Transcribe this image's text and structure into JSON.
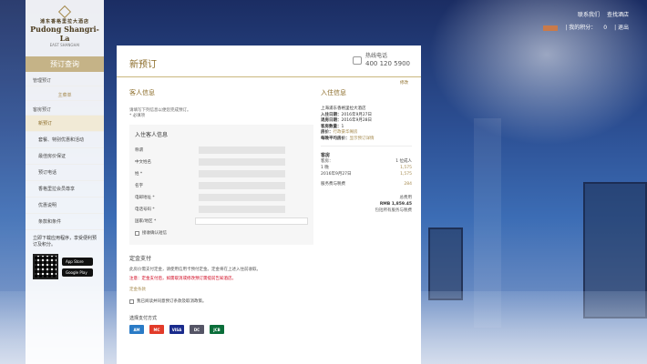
{
  "topbar": {
    "contact_us": "联系我们",
    "hotel_search": "查找酒店",
    "points_label": "| 我的积分：",
    "points_value": "0",
    "logout": "| 退出"
  },
  "sidebar": {
    "logo_cn": "浦东香格里拉大酒店",
    "logo_en": "Pudong Shangri-La",
    "logo_sub": "EAST SHANGHAI",
    "title": "预订查询",
    "group_manage": "管理预订",
    "section_center": "主菜单",
    "group_book": "客房预订",
    "items": [
      {
        "label": "新预订"
      },
      {
        "label": "套餐、特别优惠和活动"
      },
      {
        "label": "最佳房价保证"
      },
      {
        "label": "预订电话"
      },
      {
        "label": "香格里拉会员尊享"
      },
      {
        "label": "优惠说明"
      },
      {
        "label": "条款和条件"
      }
    ],
    "promo": "立即下载应用程序，享受便利预订及积分。",
    "app_store": "App Store",
    "google_play": "Google Play"
  },
  "panel": {
    "title": "新预订",
    "phone_label": "热线电话",
    "phone_number": "400 120 5900",
    "edit": "修改",
    "guest_info_title": "客人信息",
    "note_line1": "请填写下列信息以便您完成预订。",
    "note_line2": "* 必填项",
    "guest_sub": "入住客人信息",
    "fields": [
      {
        "label": "称谓"
      },
      {
        "label": "中文姓名"
      },
      {
        "label": "姓 *"
      },
      {
        "label": "名字"
      },
      {
        "label": "电邮地址 *"
      },
      {
        "label": "电话号码 *"
      },
      {
        "label": "国家/地区 *"
      }
    ],
    "send_confirm": "接收确认短信",
    "deposit_title": "定金支付",
    "deposit_text": "此房价需支付定金，请使用信用卡预付定金。定金将在上述入住前收取。",
    "red_note": "注意：定金支付后，如需取消或修改预订需提前告知酒店。",
    "deposit_link": "定金条款",
    "agree_text": "我已阅读并同意预订条款及取消政策。",
    "pay_title": "选择支付方式",
    "stay_title": "入住信息",
    "hotel_name": "上海浦东香格里拉大酒店",
    "checkin_label": "入住日期：",
    "checkin_value": "2016年9月27日",
    "checkout_label": "退房日期：",
    "checkout_value": "2016年9月28日",
    "guests_label": "客房数量：",
    "guests_value": "1",
    "rate_label": "房价：",
    "rate_value": "行政豪华阁房",
    "rate_avg_label": "每晚平均房价：",
    "rate_avg_value": "显示预订详情",
    "rooms_head": "客房",
    "room_row_label": "客房：",
    "room_row_value": "1 位成人",
    "room_line1_date": "1 晚",
    "room_line1_amt": "1,575",
    "room_line2_date": "2016年9月27日",
    "room_line2_amt": "1,575",
    "service_label": "服务费与税费",
    "service_amt": "284",
    "total_label": "总费用",
    "total_amt": "RMB 1,859.45",
    "total_note": "包括所有服务与税费"
  }
}
